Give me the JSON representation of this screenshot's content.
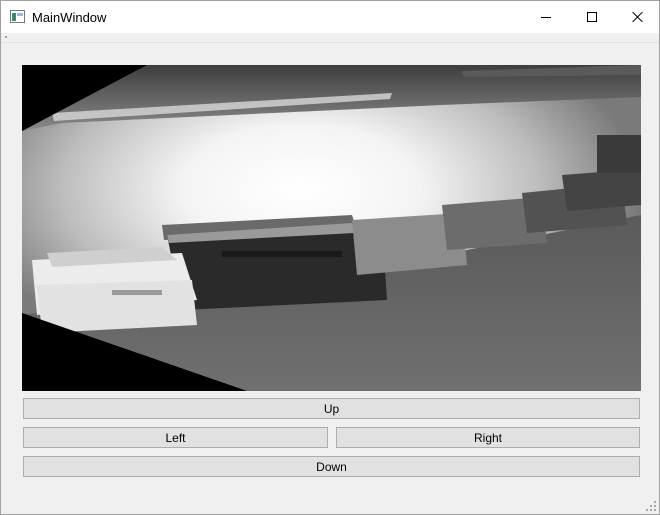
{
  "window": {
    "title": "MainWindow",
    "controls": {
      "minimize_icon": "minimize-icon",
      "maximize_icon": "maximize-icon",
      "close_icon": "close-icon"
    }
  },
  "camera": {
    "content": "grayscale camera feed of an office corridor with printers"
  },
  "buttons": {
    "up": "Up",
    "left": "Left",
    "right": "Right",
    "down": "Down"
  },
  "colors": {
    "window_bg": "#f0f0f0",
    "titlebar_bg": "#ffffff",
    "button_bg": "#e1e1e1",
    "button_border": "#adadad"
  }
}
